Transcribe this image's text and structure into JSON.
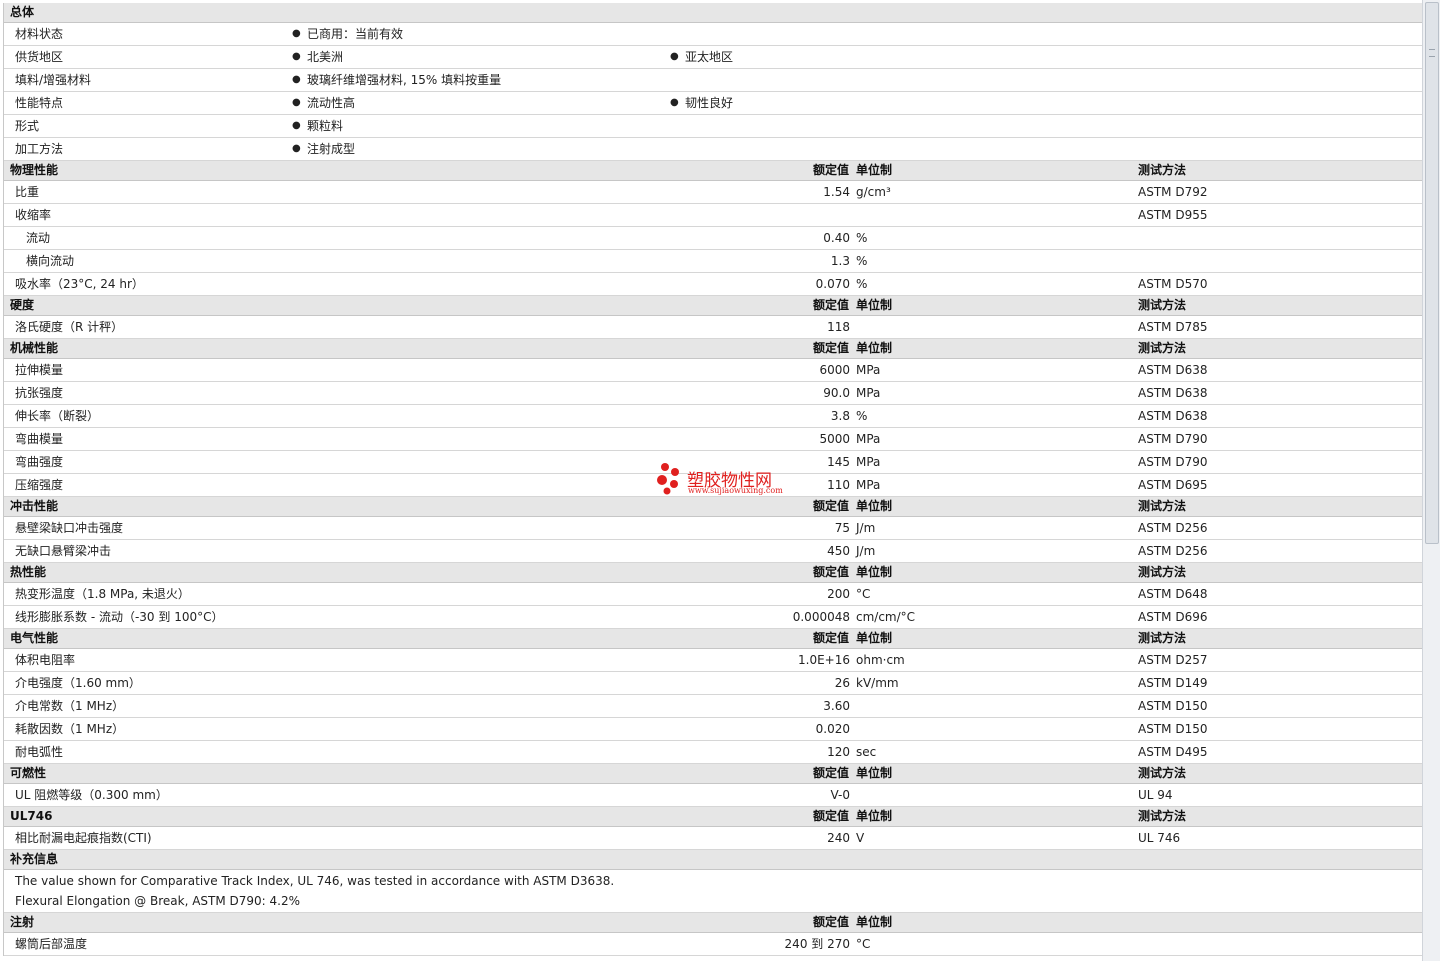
{
  "general": {
    "title": "总体",
    "rows": [
      {
        "label": "材料状态",
        "items": [
          "已商用：当前有效"
        ]
      },
      {
        "label": "供货地区",
        "items": [
          "北美洲",
          "亚太地区"
        ]
      },
      {
        "label": "填料/增强材料",
        "items": [
          "玻璃纤维增强材料, 15% 填料按重量"
        ]
      },
      {
        "label": "性能特点",
        "items": [
          "流动性高",
          "韧性良好"
        ]
      },
      {
        "label": "形式",
        "items": [
          "颗粒料"
        ]
      },
      {
        "label": "加工方法",
        "items": [
          "注射成型"
        ]
      }
    ]
  },
  "columns": {
    "nominal": "额定值",
    "unit": "单位制",
    "test": "测试方法"
  },
  "sections": [
    {
      "title": "物理性能",
      "rows": [
        {
          "label": "比重",
          "value": "1.54",
          "unit": "g/cm³",
          "test": "ASTM D792"
        },
        {
          "label": "收缩率",
          "value": "",
          "unit": "",
          "test": "ASTM D955"
        },
        {
          "label": "流动",
          "value": "0.40",
          "unit": "%",
          "test": "",
          "sub": true
        },
        {
          "label": "横向流动",
          "value": "1.3",
          "unit": "%",
          "test": "",
          "sub": true
        },
        {
          "label": "吸水率（23°C, 24 hr）",
          "value": "0.070",
          "unit": "%",
          "test": "ASTM D570"
        }
      ]
    },
    {
      "title": "硬度",
      "rows": [
        {
          "label": "洛氏硬度（R 计秤）",
          "value": "118",
          "unit": "",
          "test": "ASTM D785"
        }
      ]
    },
    {
      "title": "机械性能",
      "rows": [
        {
          "label": "拉伸模量",
          "value": "6000",
          "unit": "MPa",
          "test": "ASTM D638"
        },
        {
          "label": "抗张强度",
          "value": "90.0",
          "unit": "MPa",
          "test": "ASTM D638"
        },
        {
          "label": "伸长率（断裂）",
          "value": "3.8",
          "unit": "%",
          "test": "ASTM D638"
        },
        {
          "label": "弯曲模量",
          "value": "5000",
          "unit": "MPa",
          "test": "ASTM D790"
        },
        {
          "label": "弯曲强度",
          "value": "145",
          "unit": "MPa",
          "test": "ASTM D790"
        },
        {
          "label": "压缩强度",
          "value": "110",
          "unit": "MPa",
          "test": "ASTM D695"
        }
      ]
    },
    {
      "title": "冲击性能",
      "rows": [
        {
          "label": "悬壁梁缺口冲击强度",
          "value": "75",
          "unit": "J/m",
          "test": "ASTM D256"
        },
        {
          "label": "无缺口悬臂梁冲击",
          "value": "450",
          "unit": "J/m",
          "test": "ASTM D256"
        }
      ]
    },
    {
      "title": "热性能",
      "rows": [
        {
          "label": "热变形温度（1.8 MPa, 未退火）",
          "value": "200",
          "unit": "°C",
          "test": "ASTM D648"
        },
        {
          "label": "线形膨胀系数 - 流动（-30 到 100°C）",
          "value": "0.000048",
          "unit": "cm/cm/°C",
          "test": "ASTM D696"
        }
      ]
    },
    {
      "title": "电气性能",
      "rows": [
        {
          "label": "体积电阻率",
          "value": "1.0E+16",
          "unit": "ohm·cm",
          "test": "ASTM D257"
        },
        {
          "label": "介电强度（1.60 mm）",
          "value": "26",
          "unit": "kV/mm",
          "test": "ASTM D149"
        },
        {
          "label": "介电常数（1 MHz）",
          "value": "3.60",
          "unit": "",
          "test": "ASTM D150"
        },
        {
          "label": "耗散因数（1 MHz）",
          "value": "0.020",
          "unit": "",
          "test": "ASTM D150"
        },
        {
          "label": "耐电弧性",
          "value": "120",
          "unit": "sec",
          "test": "ASTM D495"
        }
      ]
    },
    {
      "title": "可燃性",
      "rows": [
        {
          "label": "UL 阻燃等级（0.300 mm）",
          "value": "V-0",
          "unit": "",
          "test": "UL 94"
        }
      ]
    },
    {
      "title": "UL746",
      "rows": [
        {
          "label": "相比耐漏电起痕指数(CTI)",
          "value": "240",
          "unit": "V",
          "test": "UL 746"
        }
      ]
    }
  ],
  "supplement": {
    "title": "补充信息",
    "notes": [
      "The value shown for Comparative Track Index, UL 746, was tested in accordance with ASTM D3638.",
      "Flexural Elongation @ Break, ASTM D790: 4.2%"
    ]
  },
  "injection": {
    "title": "注射",
    "rows": [
      {
        "label": "螺筒后部温度",
        "value": "240 到 270",
        "unit": "°C",
        "test": ""
      }
    ]
  },
  "watermark": {
    "name": "塑胶物性网",
    "url": "www.sujiaowuxing.com",
    "color": "#e0201f"
  }
}
